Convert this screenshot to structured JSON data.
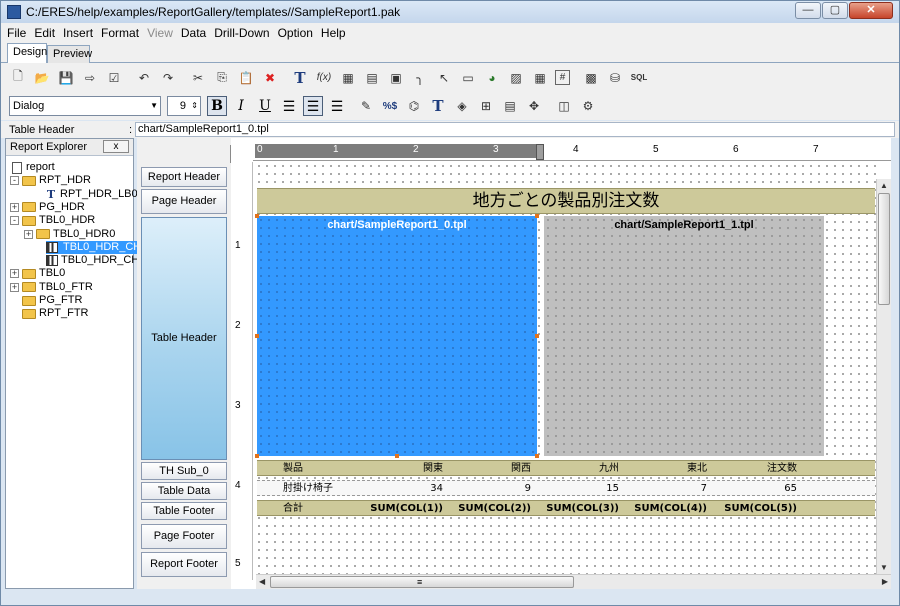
{
  "window": {
    "title": "C:/ERES/help/examples/ReportGallery/templates//SampleReport1.pak",
    "min": "—",
    "max": "▢",
    "close": "✕"
  },
  "menu": [
    {
      "label": "File",
      "disabled": false
    },
    {
      "label": "Edit",
      "disabled": false
    },
    {
      "label": "Insert",
      "disabled": false
    },
    {
      "label": "Format",
      "disabled": false
    },
    {
      "label": "View",
      "disabled": true
    },
    {
      "label": "Data",
      "disabled": false
    },
    {
      "label": "Drill-Down",
      "disabled": false
    },
    {
      "label": "Option",
      "disabled": false
    },
    {
      "label": "Help",
      "disabled": false
    }
  ],
  "tabs": {
    "design": "Design",
    "preview": "Preview"
  },
  "toolbar": {
    "font_name": "Dialog",
    "font_size": "9",
    "bold": "B",
    "italic": "I",
    "underline": "U",
    "formula": "f(x)",
    "sql": "SQL",
    "hash": "#",
    "text_tool": "T",
    "percent": "%$"
  },
  "selection": {
    "label": "Table Header",
    "colon": ":",
    "value": "chart/SampleReport1_0.tpl"
  },
  "explorer": {
    "title": "Report Explorer",
    "close": "x",
    "nodes": [
      {
        "label": "report",
        "icon": "doc",
        "expander": ""
      },
      {
        "label": "RPT_HDR",
        "icon": "folder",
        "expander": "-"
      },
      {
        "label": "RPT_HDR_LB0",
        "icon": "text",
        "expander": ""
      },
      {
        "label": "PG_HDR",
        "icon": "folder",
        "expander": "+"
      },
      {
        "label": "TBL0_HDR",
        "icon": "folder",
        "expander": "-"
      },
      {
        "label": "TBL0_HDR0",
        "icon": "folder",
        "expander": "+"
      },
      {
        "label": "TBL0_HDR_CHT0",
        "icon": "chart",
        "expander": "",
        "selected": true
      },
      {
        "label": "TBL0_HDR_CHT1",
        "icon": "chart",
        "expander": ""
      },
      {
        "label": "TBL0",
        "icon": "folder",
        "expander": "+"
      },
      {
        "label": "TBL0_FTR",
        "icon": "folder",
        "expander": "+"
      },
      {
        "label": "PG_FTR",
        "icon": "folder",
        "expander": ""
      },
      {
        "label": "RPT_FTR",
        "icon": "folder",
        "expander": ""
      }
    ]
  },
  "ruler_units": "in",
  "bands": [
    "Report Header",
    "Page Header",
    "Table Header",
    "TH Sub_0",
    "Table Data",
    "Table Footer",
    "Page Footer",
    "Report Footer"
  ],
  "hruler": {
    "start": "0",
    "nums": [
      "1",
      "2",
      "3",
      "4",
      "5",
      "6",
      "7"
    ]
  },
  "vruler": [
    "1",
    "2",
    "3",
    "4",
    "5"
  ],
  "report": {
    "title": "地方ごとの製品別注文数",
    "chart0": "chart/SampleReport1_0.tpl",
    "chart1": "chart/SampleReport1_1.tpl",
    "header_row": [
      "製品",
      "関東",
      "関西",
      "九州",
      "東北",
      "注文数"
    ],
    "data_row": [
      "肘掛け椅子",
      "34",
      "9",
      "15",
      "7",
      "65"
    ],
    "footer_row": [
      "合計",
      "SUM(COL(1))",
      "SUM(COL(2))",
      "SUM(COL(3))",
      "SUM(COL(4))",
      "SUM(COL(5))"
    ]
  },
  "scroll": {
    "left": "◀",
    "right": "▶",
    "up": "▲",
    "down": "▼",
    "grip": "≡"
  }
}
